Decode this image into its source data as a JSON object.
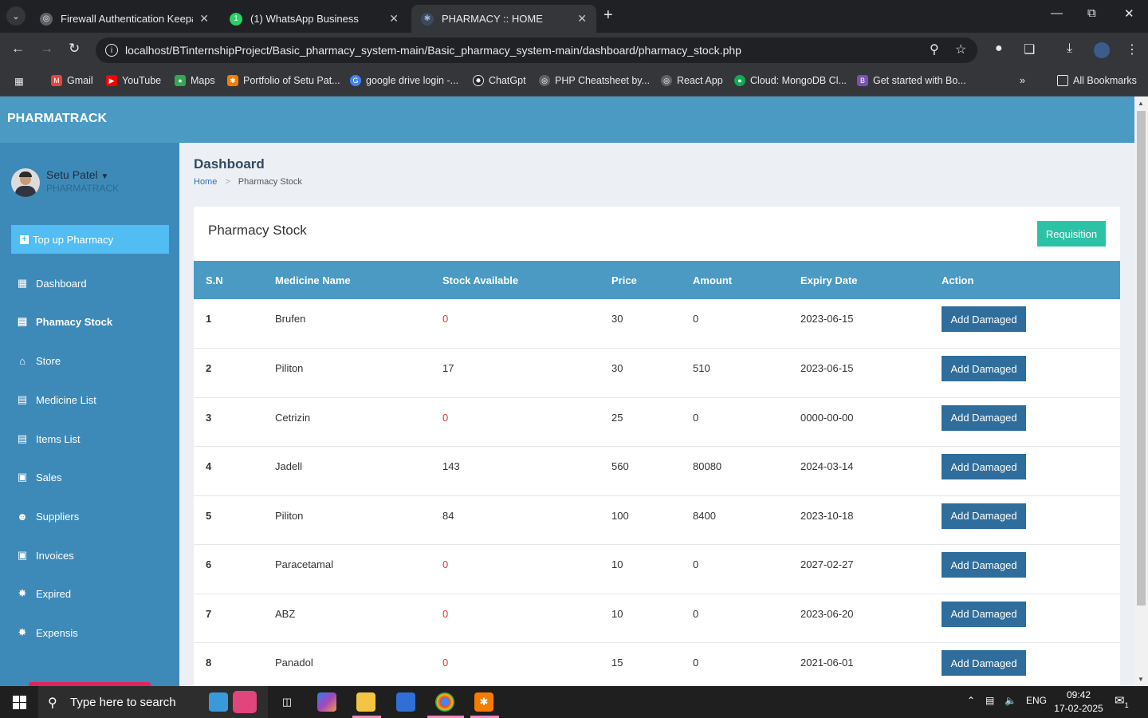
{
  "browser": {
    "tabs": [
      {
        "title": "Firewall Authentication Keepaliv",
        "active": false,
        "favicon": "globe-icon"
      },
      {
        "title": "(1) WhatsApp Business",
        "active": false,
        "favicon": "whatsapp-icon"
      },
      {
        "title": "PHARMACY :: HOME",
        "active": true,
        "favicon": "pharmacy-icon"
      }
    ],
    "url": "localhost/BTinternshipProject/Basic_pharmacy_system-main/Basic_pharmacy_system-main/dashboard/pharmacy_stock.php",
    "bookmarks": [
      {
        "label": "Gmail",
        "icon": "gmail-icon"
      },
      {
        "label": "YouTube",
        "icon": "youtube-icon"
      },
      {
        "label": "Maps",
        "icon": "maps-icon"
      },
      {
        "label": "Portfolio of Setu Pat...",
        "icon": "portfolio-icon"
      },
      {
        "label": "google drive login -...",
        "icon": "google-icon"
      },
      {
        "label": "ChatGpt",
        "icon": "chatgpt-icon"
      },
      {
        "label": "PHP Cheatsheet by...",
        "icon": "globe-icon"
      },
      {
        "label": "React App",
        "icon": "globe-icon"
      },
      {
        "label": "Cloud: MongoDB Cl...",
        "icon": "mongodb-icon"
      },
      {
        "label": "Get started with Bo...",
        "icon": "bootstrap-icon"
      }
    ],
    "all_bookmarks": "All Bookmarks"
  },
  "app": {
    "brand": "PHARMATRACK",
    "user": {
      "name": "Setu Patel",
      "role": "PHARMATRACK"
    },
    "topup_label": "Top up Pharmacy",
    "menu": [
      {
        "label": "Dashboard",
        "icon": "dashboard-icon",
        "active": false
      },
      {
        "label": "Phamacy Stock",
        "icon": "clipboard-icon",
        "active": true
      },
      {
        "label": "Store",
        "icon": "home-icon",
        "active": false
      },
      {
        "label": "Medicine List",
        "icon": "clipboard-icon",
        "active": false
      },
      {
        "label": "Items List",
        "icon": "clipboard-icon",
        "active": false
      },
      {
        "label": "Sales",
        "icon": "money-icon",
        "active": false
      },
      {
        "label": "Suppliers",
        "icon": "user-icon",
        "active": false
      },
      {
        "label": "Invoices",
        "icon": "money-icon",
        "active": false
      },
      {
        "label": "Expired",
        "icon": "alert-icon",
        "active": false
      },
      {
        "label": "Expensis",
        "icon": "alert-icon",
        "active": false
      }
    ],
    "page_title": "Dashboard",
    "breadcrumb": {
      "home": "Home",
      "current": "Pharmacy Stock"
    },
    "card_title": "Pharmacy Stock",
    "requisition_label": "Requisition",
    "table": {
      "headers": [
        "S.N",
        "Medicine Name",
        "Stock Available",
        "Price",
        "Amount",
        "Expiry Date",
        "Action"
      ],
      "rows": [
        {
          "sn": "1",
          "name": "Brufen",
          "stock": "0",
          "price": "30",
          "amount": "0",
          "expiry": "2023-06-15",
          "action": "Add Damaged"
        },
        {
          "sn": "2",
          "name": "Piliton",
          "stock": "17",
          "price": "30",
          "amount": "510",
          "expiry": "2023-06-15",
          "action": "Add Damaged"
        },
        {
          "sn": "3",
          "name": "Cetrizin",
          "stock": "0",
          "price": "25",
          "amount": "0",
          "expiry": "0000-00-00",
          "action": "Add Damaged"
        },
        {
          "sn": "4",
          "name": "Jadell",
          "stock": "143",
          "price": "560",
          "amount": "80080",
          "expiry": "2024-03-14",
          "action": "Add Damaged"
        },
        {
          "sn": "5",
          "name": "Piliton",
          "stock": "84",
          "price": "100",
          "amount": "8400",
          "expiry": "2023-10-18",
          "action": "Add Damaged"
        },
        {
          "sn": "6",
          "name": "Paracetamal",
          "stock": "0",
          "price": "10",
          "amount": "0",
          "expiry": "2027-02-27",
          "action": "Add Damaged"
        },
        {
          "sn": "7",
          "name": "ABZ",
          "stock": "0",
          "price": "10",
          "amount": "0",
          "expiry": "2023-06-20",
          "action": "Add Damaged"
        },
        {
          "sn": "8",
          "name": "Panadol",
          "stock": "0",
          "price": "15",
          "amount": "0",
          "expiry": "2021-06-01",
          "action": "Add Damaged"
        }
      ]
    }
  },
  "taskbar": {
    "search_placeholder": "Type here to search",
    "language": "ENG",
    "time": "09:42",
    "date": "17-02-2025",
    "notification_count": "1"
  },
  "colors": {
    "header": "#4a9ac4",
    "sidebar": "#3d8ab9",
    "topup": "#52bdf2",
    "requisition": "#2cc2a6",
    "add_damaged": "#2e6d9c",
    "zero_stock": "#e53935"
  }
}
